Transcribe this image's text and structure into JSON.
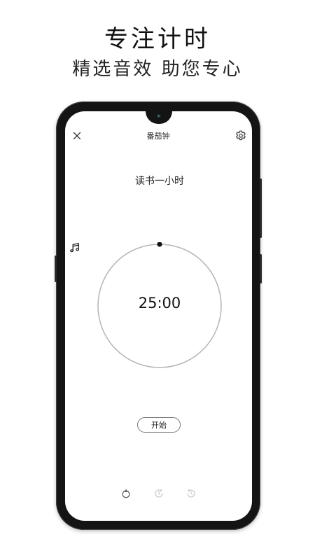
{
  "promo": {
    "title": "专注计时",
    "subtitle": "精选音效 助您专心"
  },
  "app": {
    "title": "番茄钟",
    "task_name": "读书一小时",
    "timer_value": "25:00",
    "timer_progress": 0,
    "start_label": "开始"
  },
  "icons": {
    "close": "close-icon",
    "settings": "gear-icon",
    "music": "music-note-icon",
    "nav": [
      "tomato-icon",
      "timer-icon",
      "history-icon"
    ]
  },
  "colors": {
    "dial_ring": "#b8b8b8",
    "dial_indicator": "#111111",
    "phone_frame": "#141414",
    "nav_active": "#444444",
    "nav_inactive": "#c4c4c4"
  }
}
